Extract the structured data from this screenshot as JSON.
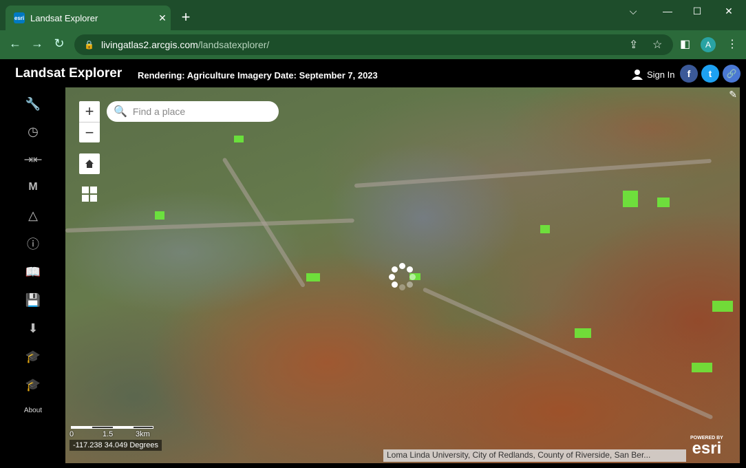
{
  "browser": {
    "tab_favicon": "esri",
    "tab_title": "Landsat Explorer",
    "tab_close": "✕",
    "new_tab": "+",
    "window_minimize": "⌵",
    "window_restore": "—",
    "window_maximize": "☐",
    "window_close": "✕",
    "back": "←",
    "forward": "→",
    "reload": "↻",
    "url_host": "livingatlas2.arcgis.com",
    "url_path": "/landsatexplorer/",
    "avatar_letter": "A"
  },
  "app": {
    "title": "Landsat Explorer",
    "rendering": "Rendering: Agriculture",
    "imagery_date": "Imagery Date: September 7, 2023",
    "sign_in": "Sign In",
    "social": {
      "facebook": "f",
      "twitter": "t",
      "link": "🔗"
    }
  },
  "sidebar": {
    "about_label": "About",
    "items": [
      "wrench-icon",
      "clock-icon",
      "swipe-icon",
      "m-icon",
      "triangle-icon",
      "info-icon",
      "bookmark-icon",
      "save-icon",
      "download-icon",
      "graduation-icon",
      "story-icon"
    ]
  },
  "map": {
    "zoom_in": "+",
    "zoom_out": "−",
    "search_placeholder": "Find a place",
    "scale_labels": [
      "0",
      "1.5",
      "3km"
    ],
    "coordinates": "-117.238 34.049 Degrees",
    "attribution": "Loma Linda University, City of Redlands, County of Riverside, San Ber...",
    "powered_by": "POWERED BY",
    "esri_logo": "esri"
  },
  "colors": {
    "browser_frame": "#1e4d2b",
    "address_bar": "#2b6a3a",
    "app_bg": "#000000",
    "accent": "#0079c1"
  }
}
